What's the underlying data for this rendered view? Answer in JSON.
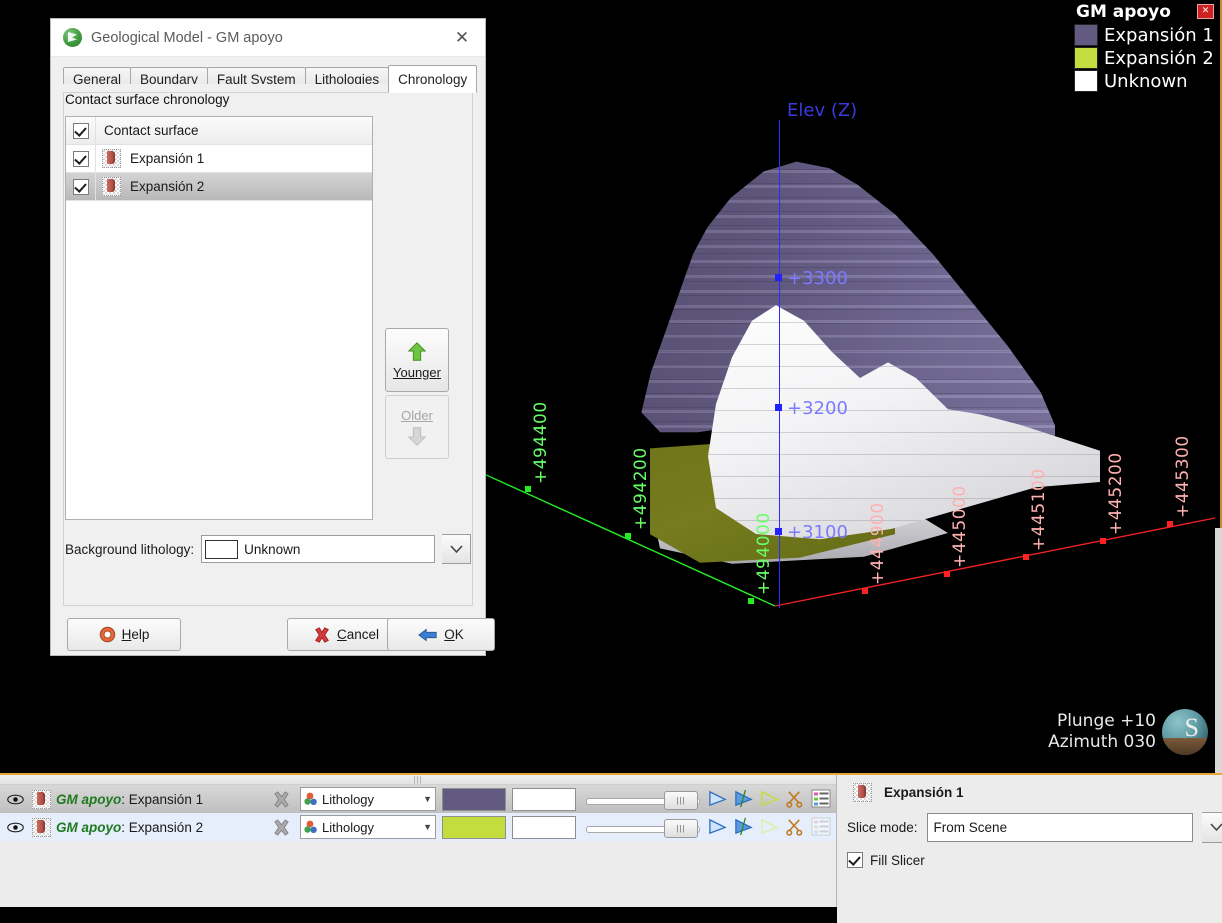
{
  "scene": {
    "legend": {
      "title": "GM apoyo",
      "close_icon": "close-icon",
      "entries": [
        {
          "label": "Expansión 1",
          "color": "#635a82"
        },
        {
          "label": "Expansión 2",
          "color": "#c3dd3e"
        },
        {
          "label": "Unknown",
          "color": "#ffffff"
        }
      ]
    },
    "axes": {
      "elevation": {
        "title": "Elev (Z)",
        "color": "#7b7bff",
        "ticks": [
          "+3300",
          "+3200",
          "+3100"
        ]
      },
      "northing": {
        "color": "#3dff3d",
        "ticks": [
          "+494400",
          "+494200",
          "+494000"
        ]
      },
      "easting": {
        "color": "#ff9a9a",
        "ticks": [
          "+444900",
          "+445000",
          "+445100",
          "+445200",
          "+445300"
        ]
      }
    },
    "viewpoint": {
      "plunge": "Plunge +10",
      "azimuth": "Azimuth 030",
      "compass_icon": "view-orientation-ball"
    }
  },
  "dialog": {
    "title": "Geological Model - GM apoyo",
    "app_icon": "geological-model-icon",
    "close_icon": "close-icon",
    "tabs": [
      {
        "label": "General",
        "active": false
      },
      {
        "label": "Boundary",
        "active": false
      },
      {
        "label": "Fault System",
        "active": false
      },
      {
        "label": "Lithologies",
        "active": false
      },
      {
        "label": "Chronology",
        "active": true
      }
    ],
    "group_title": "Contact surface chronology",
    "list": [
      {
        "label": "Contact surface",
        "checked": true,
        "has_icon": false,
        "selected": false
      },
      {
        "label": "Expansión 1",
        "checked": true,
        "has_icon": true,
        "selected": false
      },
      {
        "label": "Expansión 2",
        "checked": true,
        "has_icon": true,
        "selected": true
      }
    ],
    "buttons": {
      "younger": "Younger",
      "older": "Older",
      "help": "Help",
      "cancel": "Cancel",
      "ok": "OK"
    },
    "background_lithology": {
      "label": "Background lithology:",
      "value": "Unknown",
      "swatch": "#ffffff"
    }
  },
  "bottom": {
    "objects": [
      {
        "prefix": "GM apoyo",
        "separator": ": ",
        "name": "Expansión 1",
        "colorby": "Lithology",
        "swatch": "#635a82",
        "selected": true
      },
      {
        "prefix": "GM apoyo",
        "separator": ": ",
        "name": "Expansión 2",
        "colorby": "Lithology",
        "swatch": "#c3dd3e",
        "selected": false
      }
    ],
    "properties": {
      "title": "Expansión 1",
      "slice_mode_label": "Slice mode:",
      "slice_mode_value": "From Scene",
      "fill_slicer_label": "Fill Slicer",
      "fill_slicer_checked": true
    }
  }
}
